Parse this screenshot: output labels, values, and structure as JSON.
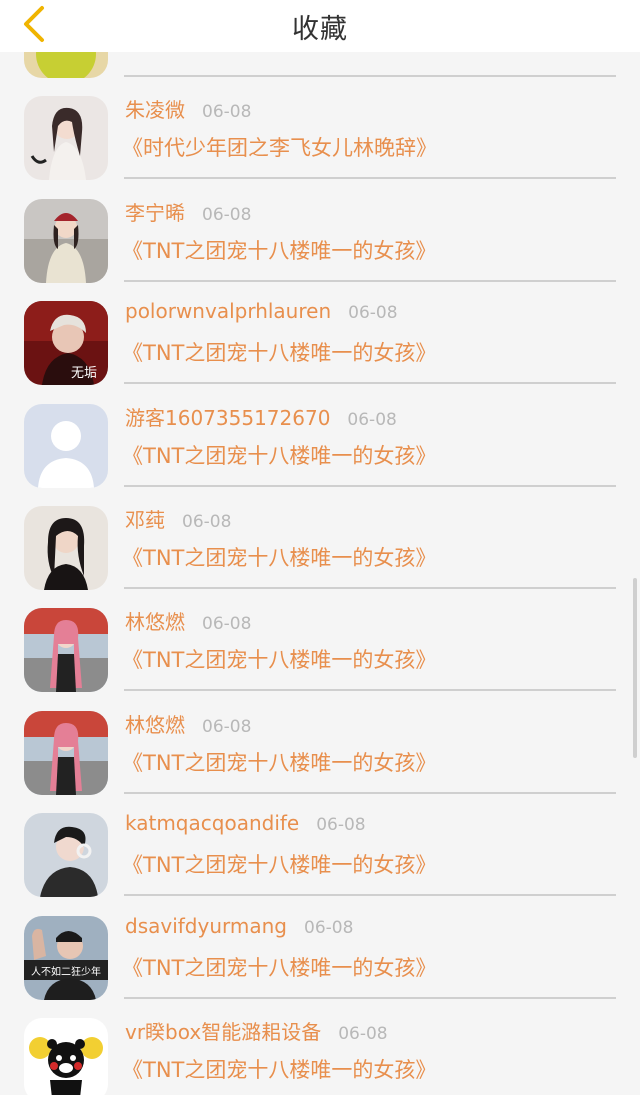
{
  "header": {
    "title": "收藏",
    "back_icon": "chevron-left-icon",
    "accent": "#f0b400"
  },
  "colors": {
    "name": "#e88f4d",
    "date": "#b8b8b8",
    "divider": "#cfcfcf"
  },
  "items": [
    {
      "name": "",
      "date": "",
      "book": "",
      "avatar": "partial-yellow"
    },
    {
      "name": "朱凌微",
      "date": "06-08",
      "book": "《时代少年团之李飞女儿林晚辞》",
      "avatar": "girl-light"
    },
    {
      "name": "李宁晞",
      "date": "06-08",
      "book": "《TNT之团宠十八楼唯一的女孩》",
      "avatar": "girl-red-hat"
    },
    {
      "name": "polorwnvalprhlauren",
      "date": "06-08",
      "book": "《TNT之团宠十八楼唯一的女孩》",
      "avatar": "boy-red",
      "avatar_text": "无垢"
    },
    {
      "name": "游客1607355172670",
      "date": "06-08",
      "book": "《TNT之团宠十八楼唯一的女孩》",
      "avatar": "default-user"
    },
    {
      "name": "邓莼",
      "date": "06-08",
      "book": "《TNT之团宠十八楼唯一的女孩》",
      "avatar": "girl-dark"
    },
    {
      "name": "林悠燃",
      "date": "06-08",
      "book": "《TNT之团宠十八楼唯一的女孩》",
      "avatar": "girl-pink-hair"
    },
    {
      "name": "林悠燃",
      "date": "06-08",
      "book": "《TNT之团宠十八楼唯一的女孩》",
      "avatar": "girl-pink-hair"
    },
    {
      "name": "katmqacqoandife",
      "date": "06-08",
      "book": "《TNT之团宠十八楼唯一的女孩》",
      "avatar": "boy-headphones"
    },
    {
      "name": "dsavifdyurmang",
      "date": "06-08",
      "book": "《TNT之团宠十八楼唯一的女孩》",
      "avatar": "boy-banner",
      "avatar_text": "人不如二狂少年"
    },
    {
      "name": "vr睽box智能潞耜设备",
      "date": "06-08",
      "book": "《TNT之团宠十八楼唯一的女孩》",
      "avatar": "kumamon"
    }
  ]
}
